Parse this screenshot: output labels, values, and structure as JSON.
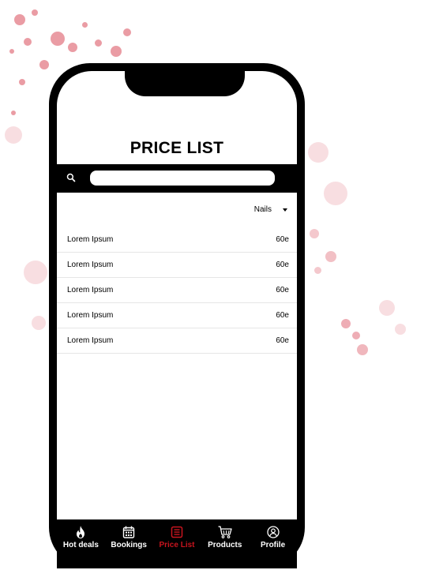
{
  "page": {
    "title": "PRICE LIST"
  },
  "search": {
    "placeholder": "",
    "value": ""
  },
  "filter": {
    "selected": "Nails"
  },
  "price_items": [
    {
      "name": "Lorem Ipsum",
      "price": "60e"
    },
    {
      "name": "Lorem Ipsum",
      "price": "60e"
    },
    {
      "name": "Lorem Ipsum",
      "price": "60e"
    },
    {
      "name": "Lorem Ipsum",
      "price": "60e"
    },
    {
      "name": "Lorem Ipsum",
      "price": "60e"
    }
  ],
  "tabs": [
    {
      "label": "Hot deals",
      "icon": "flame-icon",
      "active": false
    },
    {
      "label": "Bookings",
      "icon": "calendar-icon",
      "active": false
    },
    {
      "label": "Price List",
      "icon": "list-icon",
      "active": true
    },
    {
      "label": "Products",
      "icon": "cart-icon",
      "active": false
    },
    {
      "label": "Profile",
      "icon": "user-icon",
      "active": false
    }
  ],
  "colors": {
    "frame": "#000000",
    "accent_active": "#c8141e",
    "splatter": "#d94a5a"
  }
}
